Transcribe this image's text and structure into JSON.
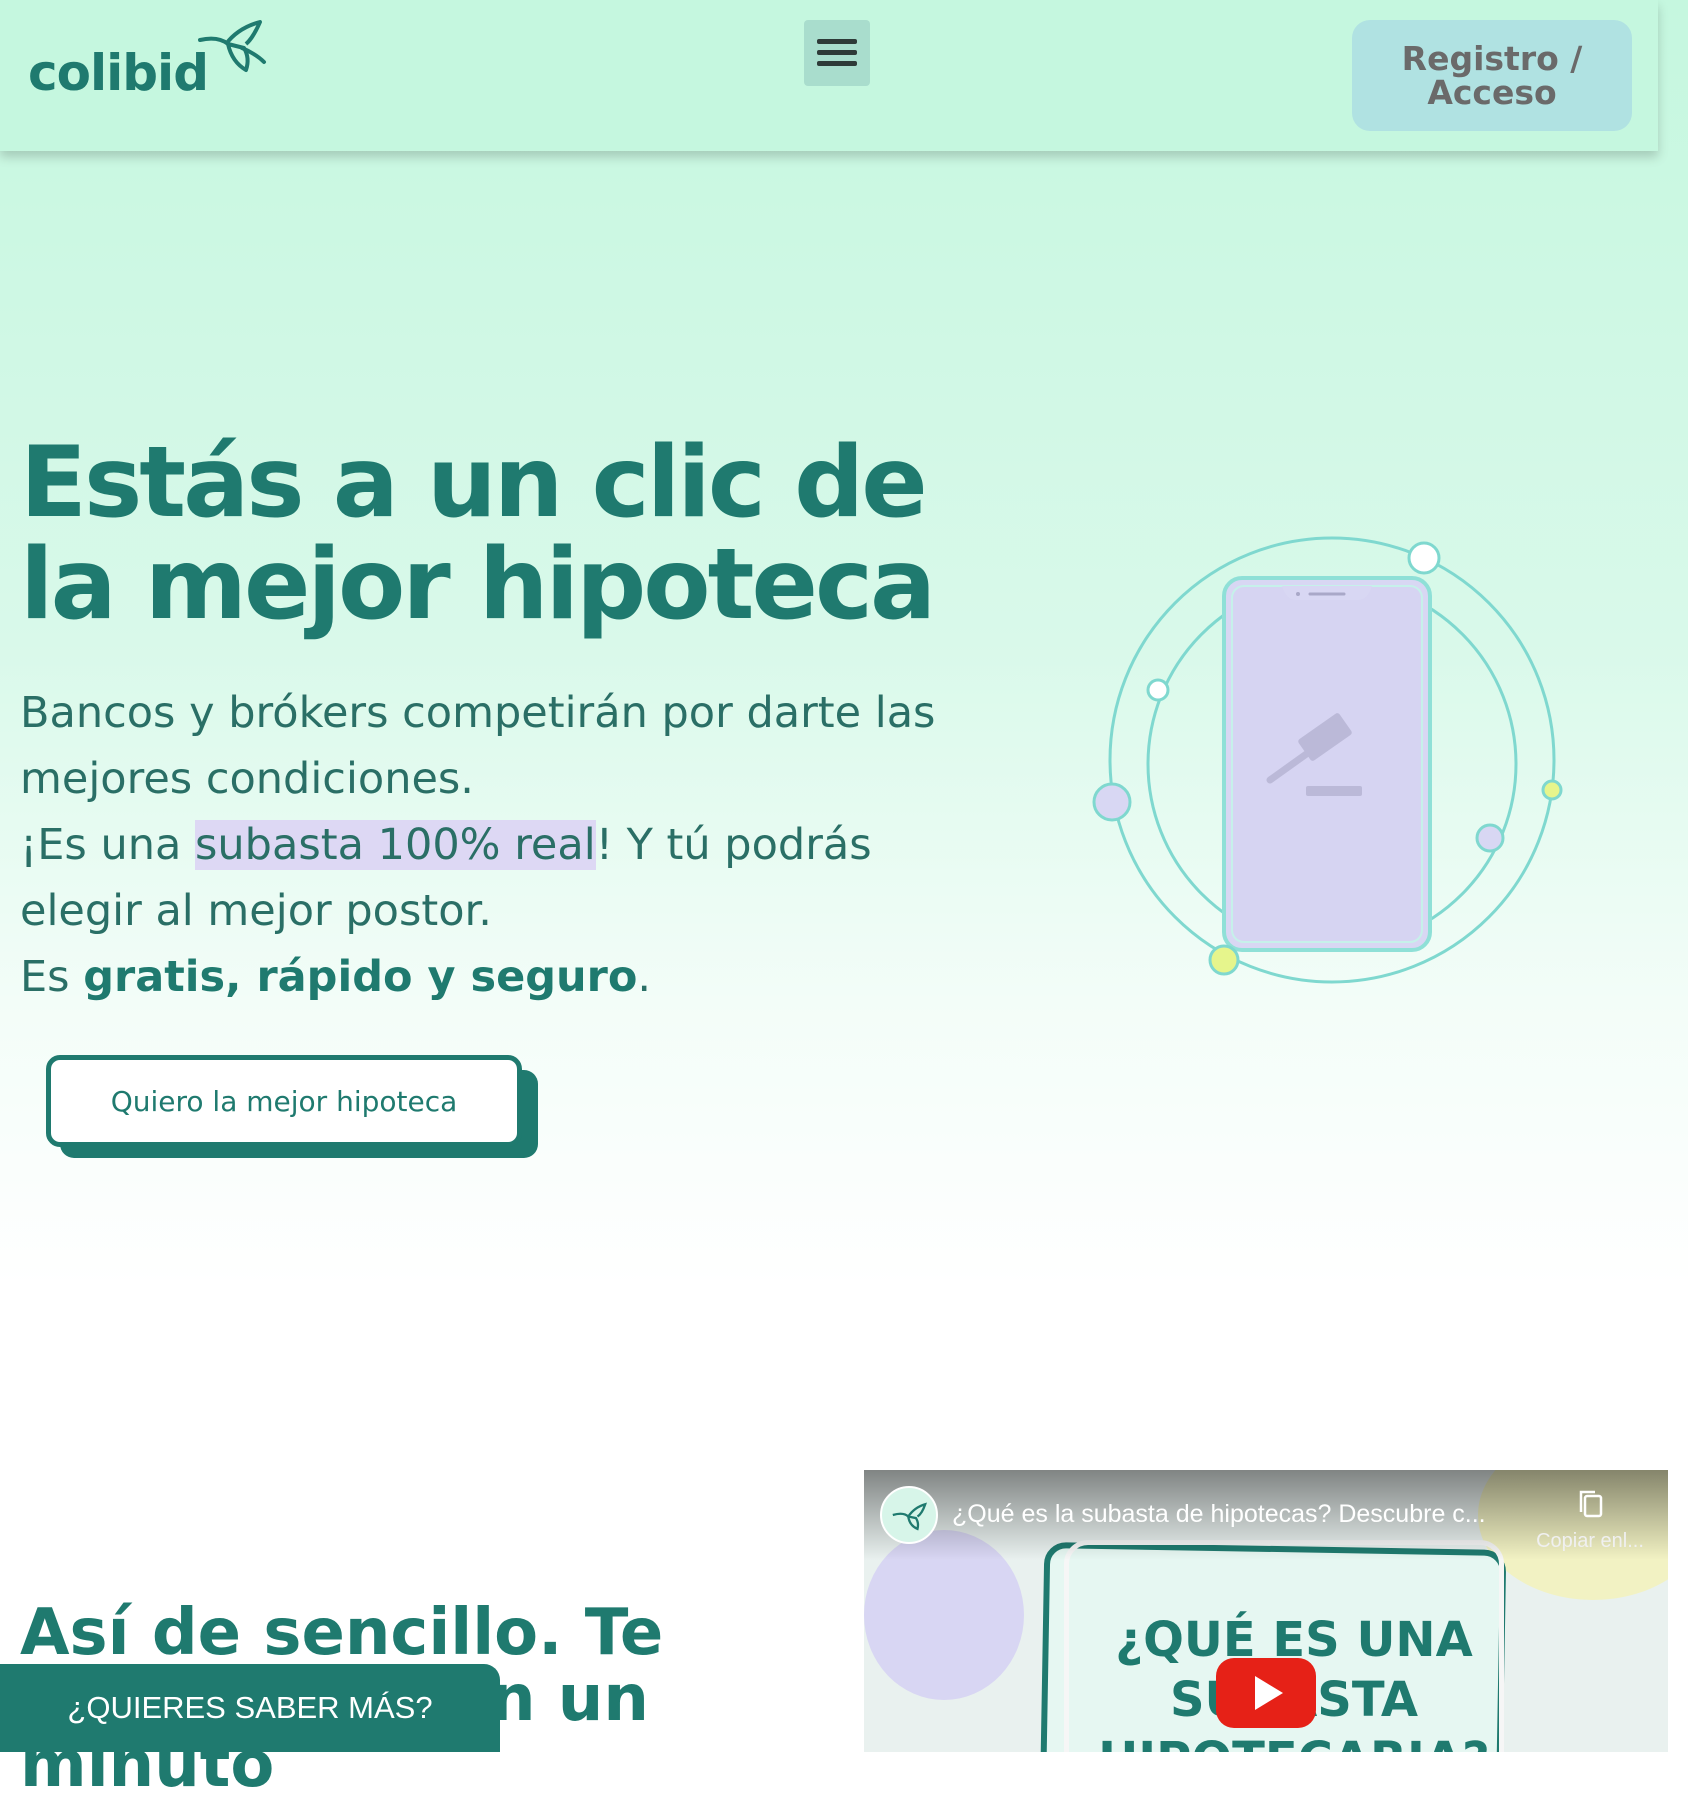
{
  "header": {
    "logo_text": "colibid",
    "menu_icon": "hamburger-menu-icon",
    "login_label": "Registro / Acceso"
  },
  "hero": {
    "title": "Estás a un clic de la mejor hipoteca",
    "line1": "Bancos y brókers competirán por darte las mejores condiciones.",
    "line2_pre": "¡Es una ",
    "line2_highlight": "subasta 100% real",
    "line2_post": "! Y tú podrás elegir al mejor postor.",
    "line3_pre": "Es ",
    "line3_bold": "gratis, rápido y seguro",
    "line3_post": ".",
    "cta_label": "Quiero la mejor hipoteca"
  },
  "section2": {
    "title": "Así de sencillo. Te explicamos en un minuto"
  },
  "video": {
    "title": "¿Qué es la subasta de hipotecas? Descubre c...",
    "copy_label": "Copiar enl...",
    "thumbnail_text": "¿QUÉ ES UNA SUBASTA HIPOTECARIA?"
  },
  "sticky": {
    "label": "¿QUIERES SABER MÁS?"
  },
  "colors": {
    "brand": "#1f7a6f",
    "header_bg": "#c5f7df",
    "login_bg": "#b0e2e2",
    "highlight": "#ddd8f4",
    "youtube_red": "#e62117"
  }
}
